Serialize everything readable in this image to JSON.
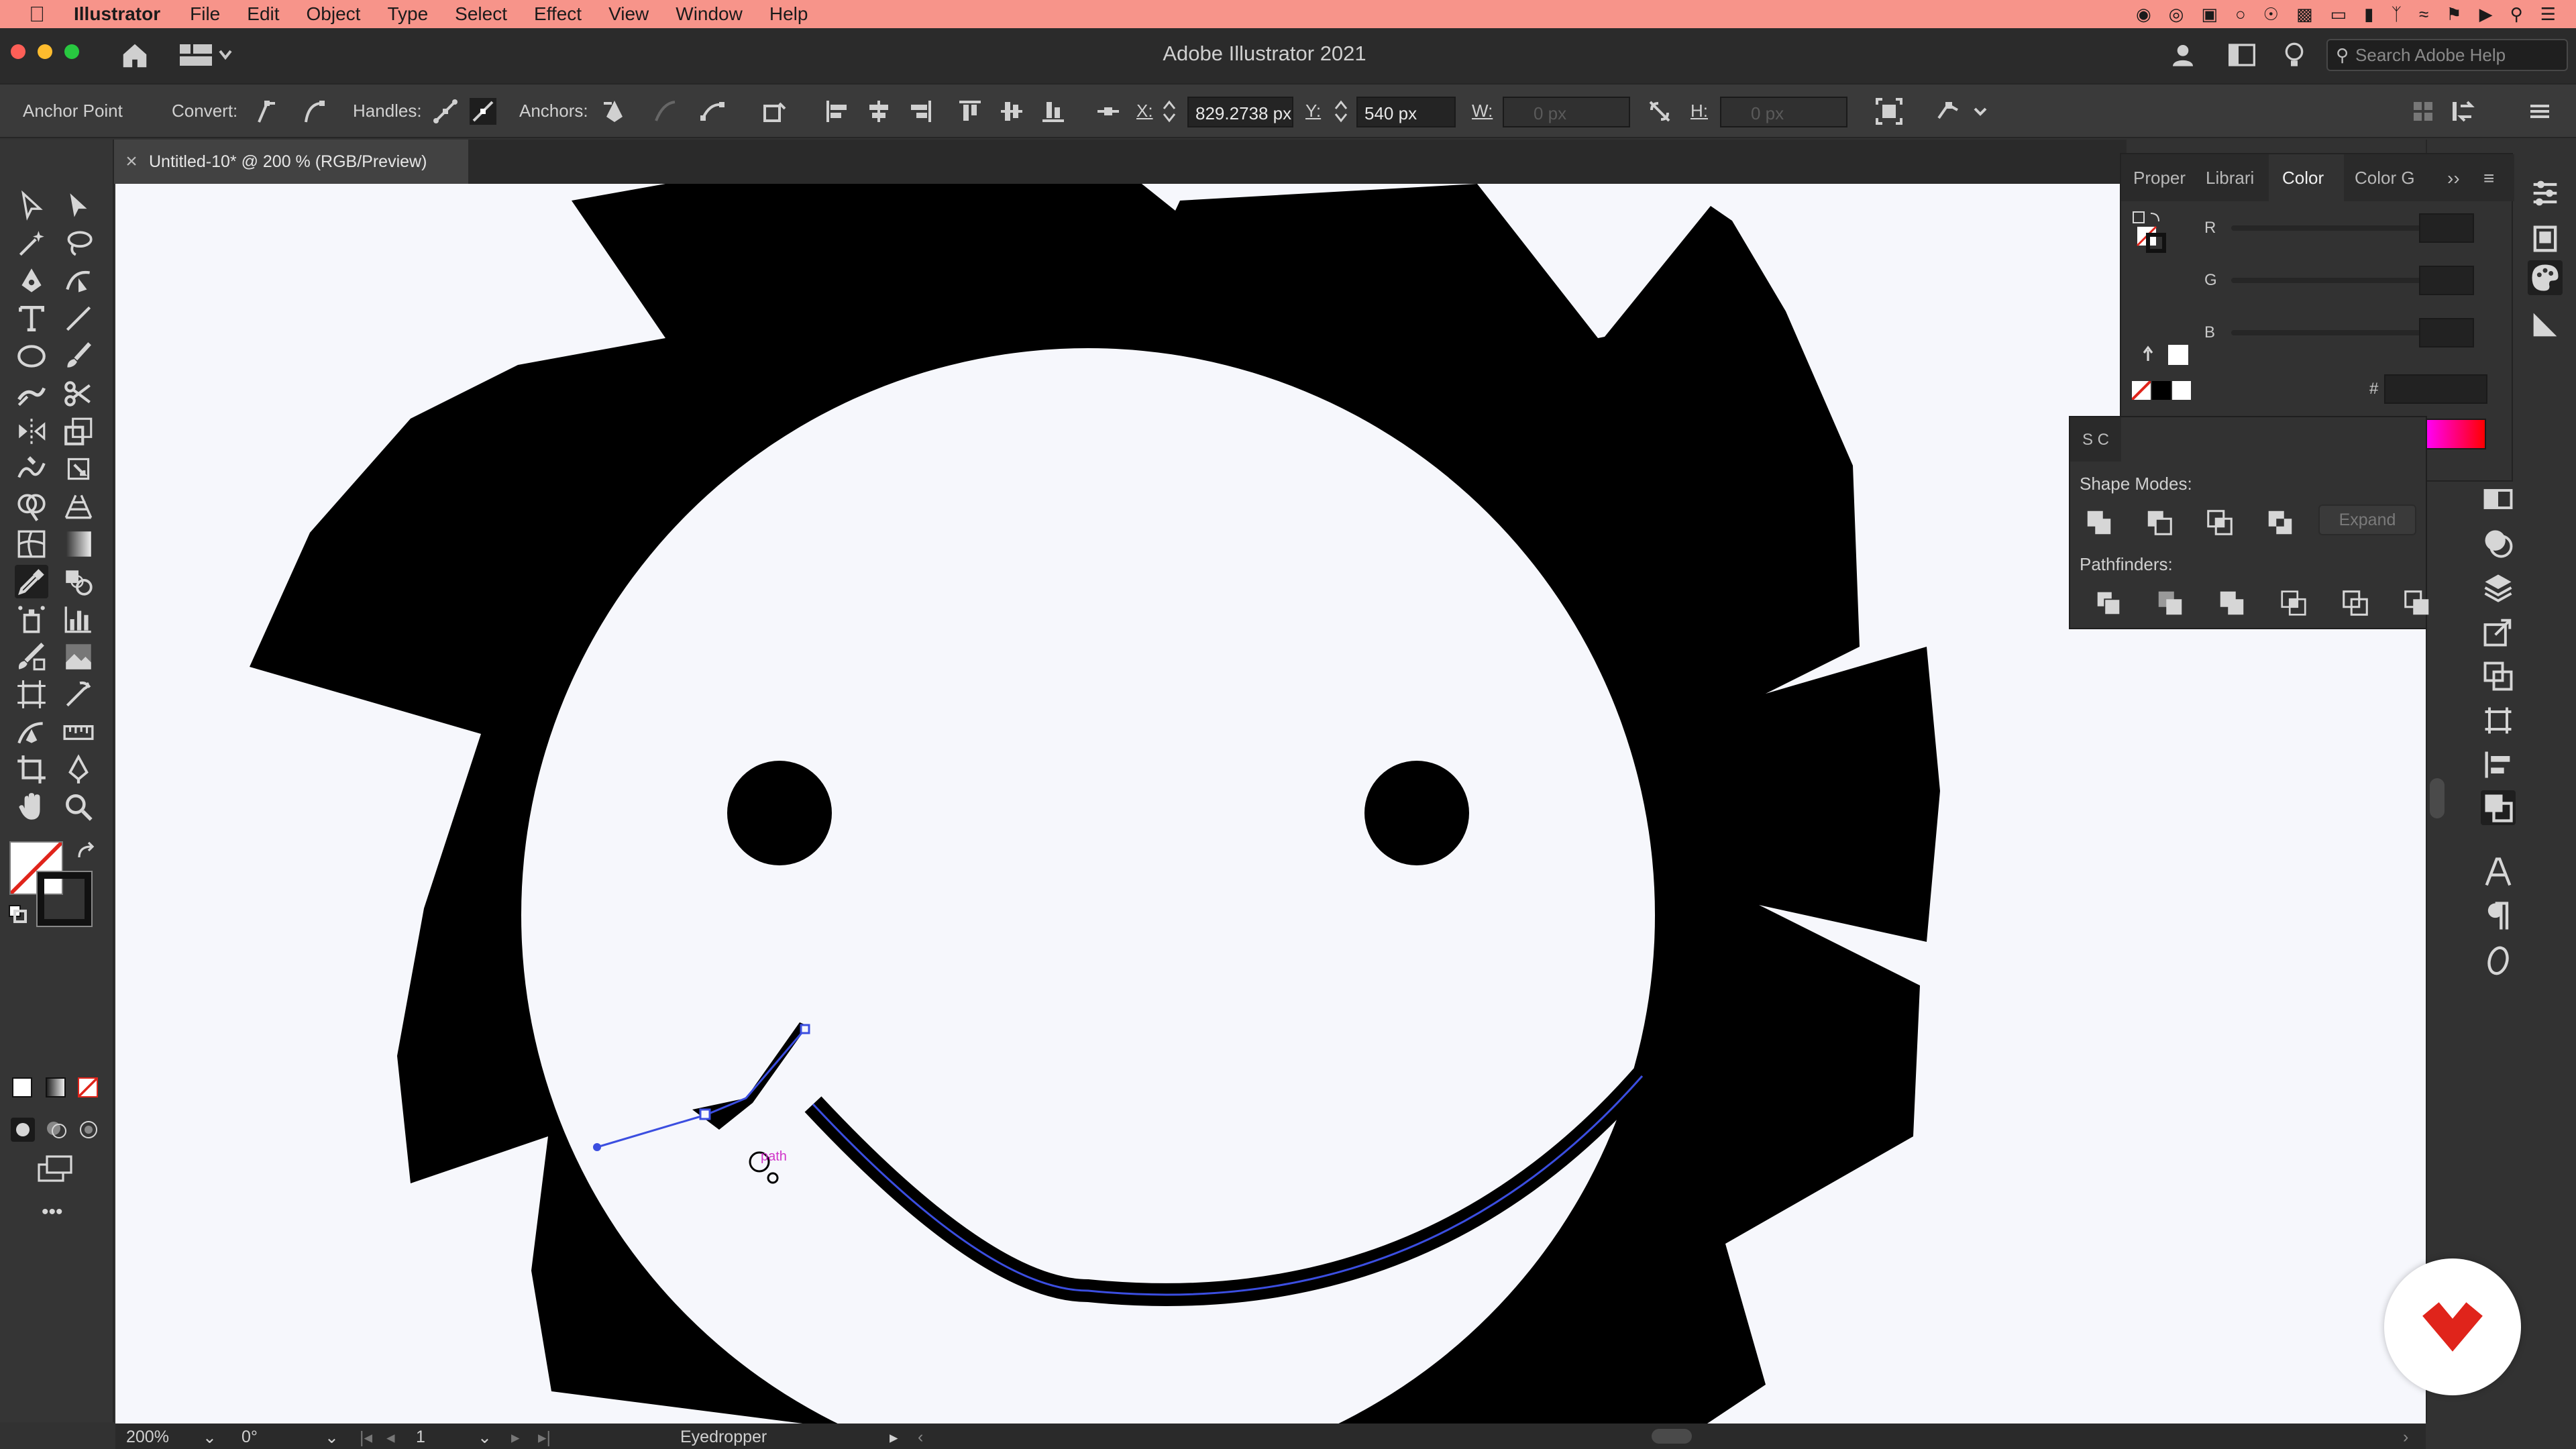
{
  "menubar": {
    "apple_icon": "apple-icon",
    "items": [
      "Illustrator",
      "File",
      "Edit",
      "Object",
      "Type",
      "Select",
      "Effect",
      "View",
      "Window",
      "Help"
    ]
  },
  "titlebar": {
    "title": "Adobe Illustrator 2021",
    "search_placeholder": "Search Adobe Help"
  },
  "controlbar": {
    "anchor_point_label": "Anchor Point",
    "convert_label": "Convert:",
    "handles_label": "Handles:",
    "anchors_label": "Anchors:",
    "x_label": "X:",
    "x_value": "829.2738 px",
    "y_label": "Y:",
    "y_value": "540 px",
    "w_label": "W:",
    "w_value": "0 px",
    "h_label": "H:",
    "h_value": "0 px"
  },
  "document": {
    "tab_title": "Untitled-10* @ 200 % (RGB/Preview)",
    "path_hint": "path"
  },
  "color_panel": {
    "tabs": [
      "Proper",
      "Librari",
      "Color",
      "Color G"
    ],
    "active_tab": "Color",
    "r_label": "R",
    "g_label": "G",
    "b_label": "B",
    "hex_label": "#"
  },
  "pathfinder_panel": {
    "collapsed_tabs": "S  C",
    "shape_modes_label": "Shape Modes:",
    "pathfinders_label": "Pathfinders:",
    "expand_label": "Expand"
  },
  "statusbar": {
    "zoom": "200%",
    "rotation": "0°",
    "artboard": "1",
    "current_tool": "Eyedropper"
  },
  "colors": {
    "menubar_bg": "#f7948a",
    "canvas_bg": "#f6f7fc",
    "artwork": "#000000",
    "selection": "#3b4ee0",
    "logo_red": "#e0241b"
  }
}
